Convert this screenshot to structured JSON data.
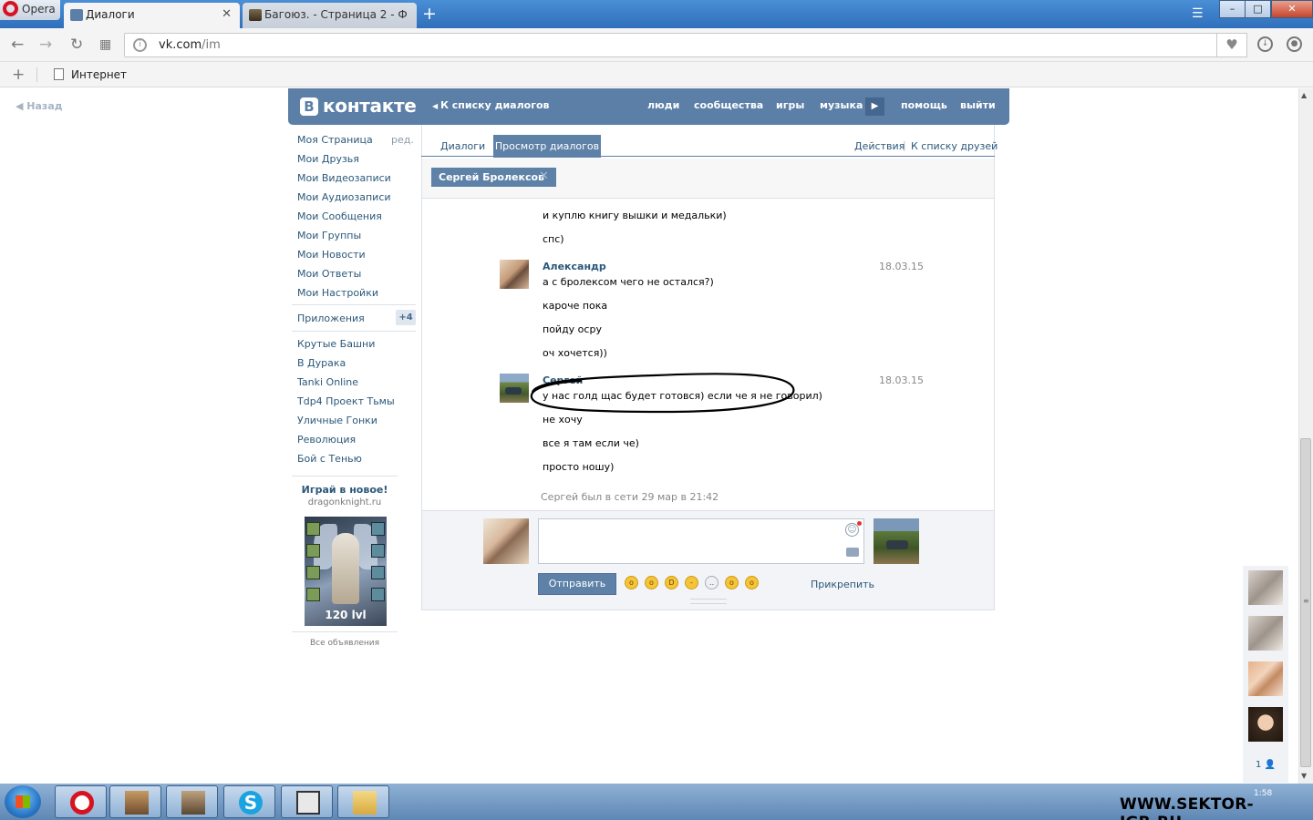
{
  "browser": {
    "menu_label": "Opera",
    "tabs": [
      {
        "title": "Диалоги"
      },
      {
        "title": "Багоюз. - Страница 2 - Ф"
      }
    ],
    "window_controls": {
      "minimize": "–",
      "maximize": "□",
      "close": "✕"
    },
    "address": {
      "host": "vk.com",
      "path": "/im"
    },
    "bookmark": "Интернет",
    "back_label": "Назад"
  },
  "vk": {
    "logo_letter": "В",
    "logo_text": "контакте",
    "back_to_list": "К списку диалогов",
    "nav": [
      "люди",
      "сообщества",
      "игры",
      "музыка",
      "помощь",
      "выйти"
    ],
    "left_menu": [
      "Моя Страница",
      "Мои Друзья",
      "Мои Видеозаписи",
      "Мои Аудиозаписи",
      "Мои Сообщения",
      "Мои Группы",
      "Мои Новости",
      "Мои Ответы",
      "Мои Настройки"
    ],
    "edit_label": "ред.",
    "apps_label": "Приложения",
    "apps_badge": "+4",
    "games": [
      "Крутые Башни",
      "В Дурака",
      "Tanki Online",
      "Tdp4 Проект Тьмы",
      "Уличные Гонки",
      "Революция",
      "Бой с Тенью"
    ],
    "ad": {
      "title": "Играй в новое!",
      "domain": "dragonknight.ru",
      "level": "120 lvl",
      "all_ads": "Все объявления"
    },
    "tabs": {
      "dialogs": "Диалоги",
      "view": "Просмотр диалогов",
      "actions": "Действия",
      "separator": "|",
      "to_friends": "К списку друзей"
    },
    "peer_chip": "Сергей Бролексов",
    "messages": {
      "top": [
        "и куплю книгу вышки и медальки)",
        "спс)"
      ],
      "alex": {
        "author": "Александр",
        "date": "18.03.15",
        "lines": [
          "а с бролексом чего не остался?)",
          "кароче пока",
          "пойду осру",
          "оч хочется))"
        ]
      },
      "serg": {
        "author": "Сергей",
        "date": "18.03.15",
        "lines": [
          "у нас голд щас будет готовся) если че я не говорил)",
          "не хочу",
          "все я там если че)",
          "просто ношу)"
        ]
      }
    },
    "online_status": "Сергей был в сети 29 мар в 21:42",
    "send_button": "Отправить",
    "attach_label": "Прикрепить",
    "friends_online_count": "1"
  },
  "taskbar": {
    "clock_time": "1:58",
    "skype_letter": "S"
  },
  "watermark": "WWW.SEKTOR-IGR.RU",
  "colors": {
    "vk_blue": "#5b7fa6",
    "link": "#2b587a",
    "titlebar": "#3a7cc8"
  }
}
